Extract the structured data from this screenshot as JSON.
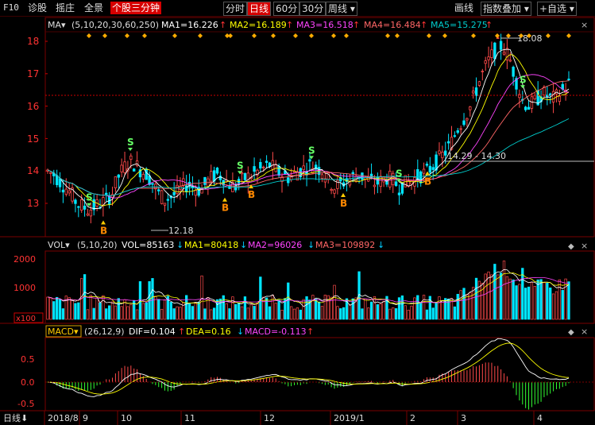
{
  "toolbar": {
    "left": [
      "F10",
      "诊股",
      "摇庄",
      "全景",
      "个股三分钟"
    ],
    "periods": [
      "分时",
      "日线",
      "60分",
      "30分",
      "周线"
    ],
    "period_selected": "日线",
    "right": [
      "画线",
      "指数叠加",
      "+自选"
    ],
    "colors": {
      "accent": "#d60000"
    }
  },
  "main_panel": {
    "indicator": "MA",
    "params": "(5,10,20,30,60,250)",
    "legend": [
      {
        "label": "MA1=16.226",
        "color": "#ffffff"
      },
      {
        "label": "MA2=16.189",
        "color": "#ffff00"
      },
      {
        "label": "MA3=16.518",
        "color": "#ff44ff"
      },
      {
        "label": "MA4=16.484",
        "color": "#ff6666"
      },
      {
        "label": "MA5=15.275",
        "color": "#00cccc"
      }
    ],
    "y_ticks": [
      "18",
      "17",
      "16",
      "15",
      "14",
      "13"
    ],
    "annotations": {
      "high": "18.08",
      "low": "12.18",
      "range": "14.29 - 14.30"
    },
    "signals": [
      {
        "type": "S",
        "x": 112
      },
      {
        "type": "B",
        "x": 130
      },
      {
        "type": "S",
        "x": 164
      },
      {
        "type": "B",
        "x": 283
      },
      {
        "type": "S",
        "x": 302
      },
      {
        "type": "B",
        "x": 316
      },
      {
        "type": "S",
        "x": 392
      },
      {
        "type": "B",
        "x": 432
      },
      {
        "type": "S",
        "x": 502
      },
      {
        "type": "B",
        "x": 538
      },
      {
        "type": "S",
        "x": 658
      }
    ]
  },
  "volume_panel": {
    "indicator": "VOL",
    "params": "(5,10,20)",
    "legend": [
      {
        "label": "VOL=85163",
        "color": "#ffffff"
      },
      {
        "label": "MA1=80418",
        "color": "#ffff00"
      },
      {
        "label": "MA2=96026",
        "color": "#ff44ff"
      },
      {
        "label": "MA3=109892",
        "color": "#ff6666"
      }
    ],
    "y_ticks": [
      "2000",
      "1000"
    ],
    "unit": "x100"
  },
  "macd_panel": {
    "indicator": "MACD",
    "params": "(26,12,9)",
    "legend": [
      {
        "label": "DIF=0.104",
        "color": "#ffffff"
      },
      {
        "label": "DEA=0.16",
        "color": "#ffff00"
      },
      {
        "label": "MACD=-0.113",
        "color": "#ff44ff"
      }
    ],
    "y_ticks": [
      "0.5",
      "0.0",
      "-0.5"
    ]
  },
  "x_axis": {
    "period_label": "日线",
    "ticks": [
      {
        "label": "2018/8",
        "x": 60
      },
      {
        "label": "9",
        "x": 104
      },
      {
        "label": "10",
        "x": 152
      },
      {
        "label": "11",
        "x": 232
      },
      {
        "label": "12",
        "x": 332
      },
      {
        "label": "2019/1",
        "x": 420
      },
      {
        "label": "2",
        "x": 516
      },
      {
        "label": "3",
        "x": 580
      },
      {
        "label": "4",
        "x": 676
      }
    ]
  },
  "chart_data": {
    "type": "candlestick",
    "period": "daily",
    "x_range": [
      "2018/8",
      "2019/4"
    ],
    "price_range": [
      12.18,
      18.08
    ],
    "close_series_approx": [
      14.0,
      13.9,
      13.7,
      13.5,
      13.3,
      13.0,
      12.9,
      12.8,
      12.9,
      13.0,
      13.1,
      13.3,
      13.8,
      14.1,
      14.3,
      14.2,
      14.0,
      13.9,
      13.6,
      13.3,
      13.1,
      13.2,
      13.3,
      13.5,
      13.6,
      13.5,
      13.4,
      13.6,
      13.8,
      13.9,
      13.8,
      13.6,
      13.5,
      13.7,
      13.8,
      13.9,
      14.0,
      14.1,
      14.2,
      14.0,
      13.9,
      13.8,
      13.9,
      14.0,
      14.1,
      14.2,
      14.1,
      14.0,
      13.7,
      13.5,
      13.6,
      13.7,
      13.8,
      13.9,
      13.8,
      13.7,
      13.6,
      13.7,
      13.8,
      13.7,
      13.5,
      13.6,
      13.7,
      13.8,
      13.9,
      14.0,
      14.2,
      14.4,
      14.6,
      14.9,
      15.3,
      15.6,
      15.9,
      16.4,
      16.9,
      17.3,
      17.6,
      17.9,
      17.8,
      17.4,
      16.8,
      16.2,
      16.0,
      16.1,
      16.3,
      16.4,
      16.2,
      16.3,
      16.5,
      16.7
    ],
    "volume_max": 2000,
    "macd_range": [
      -0.5,
      0.8
    ]
  }
}
